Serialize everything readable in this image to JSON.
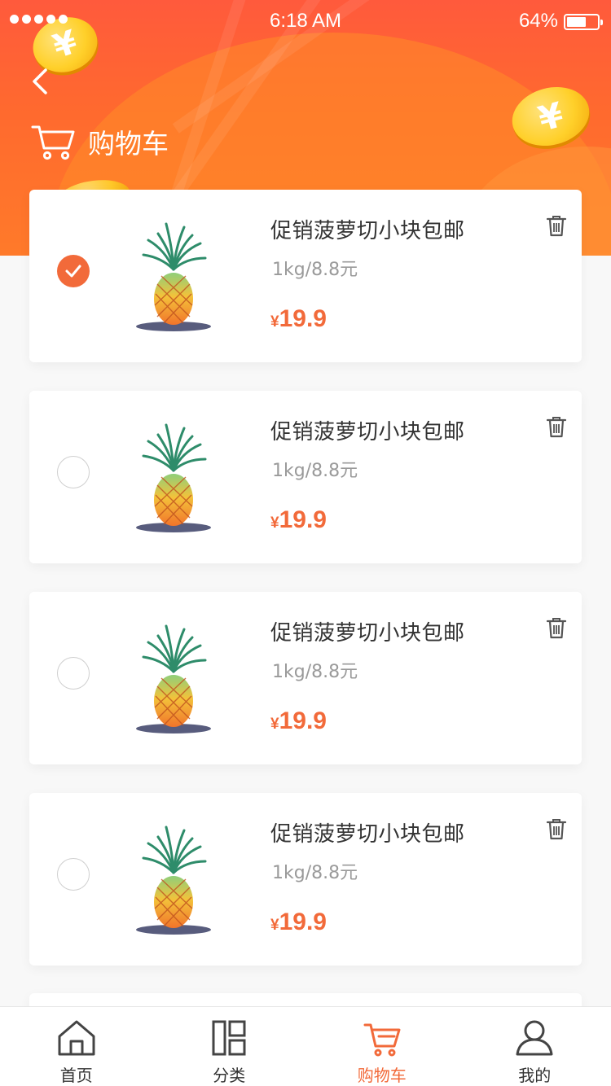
{
  "status_bar": {
    "time": "6:18 AM",
    "battery_percent": "64%",
    "battery_level": 0.64
  },
  "header": {
    "title": "购物车",
    "coin_glyph": "¥",
    "accent": "#f26a3a"
  },
  "cart": {
    "items": [
      {
        "name": "促销菠萝切小块包邮",
        "spec": "1kg/8.8元",
        "currency": "¥",
        "price": "19.9",
        "selected": true
      },
      {
        "name": "促销菠萝切小块包邮",
        "spec": "1kg/8.8元",
        "currency": "¥",
        "price": "19.9",
        "selected": false
      },
      {
        "name": "促销菠萝切小块包邮",
        "spec": "1kg/8.8元",
        "currency": "¥",
        "price": "19.9",
        "selected": false
      },
      {
        "name": "促销菠萝切小块包邮",
        "spec": "1kg/8.8元",
        "currency": "¥",
        "price": "19.9",
        "selected": false
      }
    ]
  },
  "tabbar": {
    "tabs": [
      {
        "label": "首页",
        "icon": "home-icon",
        "active": false
      },
      {
        "label": "分类",
        "icon": "category-icon",
        "active": false
      },
      {
        "label": "购物车",
        "icon": "cart-icon",
        "active": true
      },
      {
        "label": "我的",
        "icon": "user-icon",
        "active": false
      }
    ]
  }
}
